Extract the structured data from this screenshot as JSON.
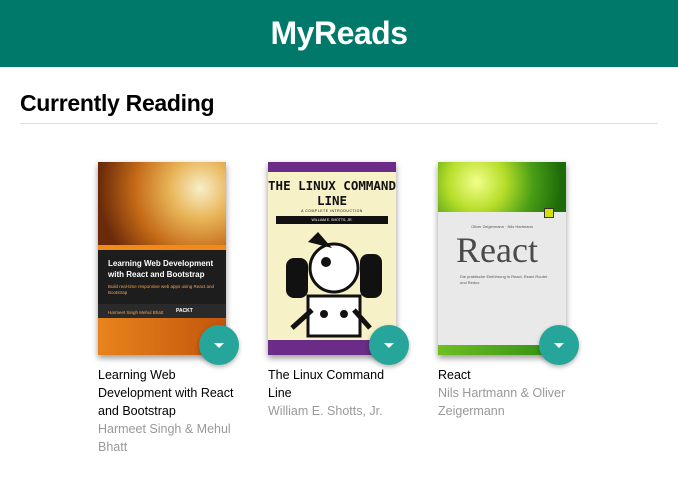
{
  "app": {
    "title": "MyReads"
  },
  "shelf": {
    "title": "Currently Reading"
  },
  "books": [
    {
      "title": "Learning Web Development with React and Bootstrap",
      "authors": "Harmeet Singh & Mehul Bhatt",
      "cover": {
        "title": "Learning Web Development with React and Bootstrap",
        "subtitle": "Build real-time responsive web apps using React and Bootstrap",
        "authors": "Harmeet Singh Mehul Bhatt",
        "publisher": "PACKT"
      }
    },
    {
      "title": "The Linux Command Line",
      "authors": "William E. Shotts, Jr.",
      "cover": {
        "title": "THE LINUX COMMAND LINE",
        "tagline": "A COMPLETE INTRODUCTION",
        "author": "WILLIAM E. SHOTTS, JR."
      }
    },
    {
      "title": "React",
      "authors": "Nils Hartmann & Oliver Zeigermann",
      "cover": {
        "authors": "Oliver Zeigermann · Nils Hartmann",
        "title": "React",
        "subtitle": "Die praktische Einführung in React, React Router und Redux"
      }
    }
  ],
  "colors": {
    "header": "#00796b",
    "changer": "#26a69a",
    "author_text": "#999999"
  }
}
